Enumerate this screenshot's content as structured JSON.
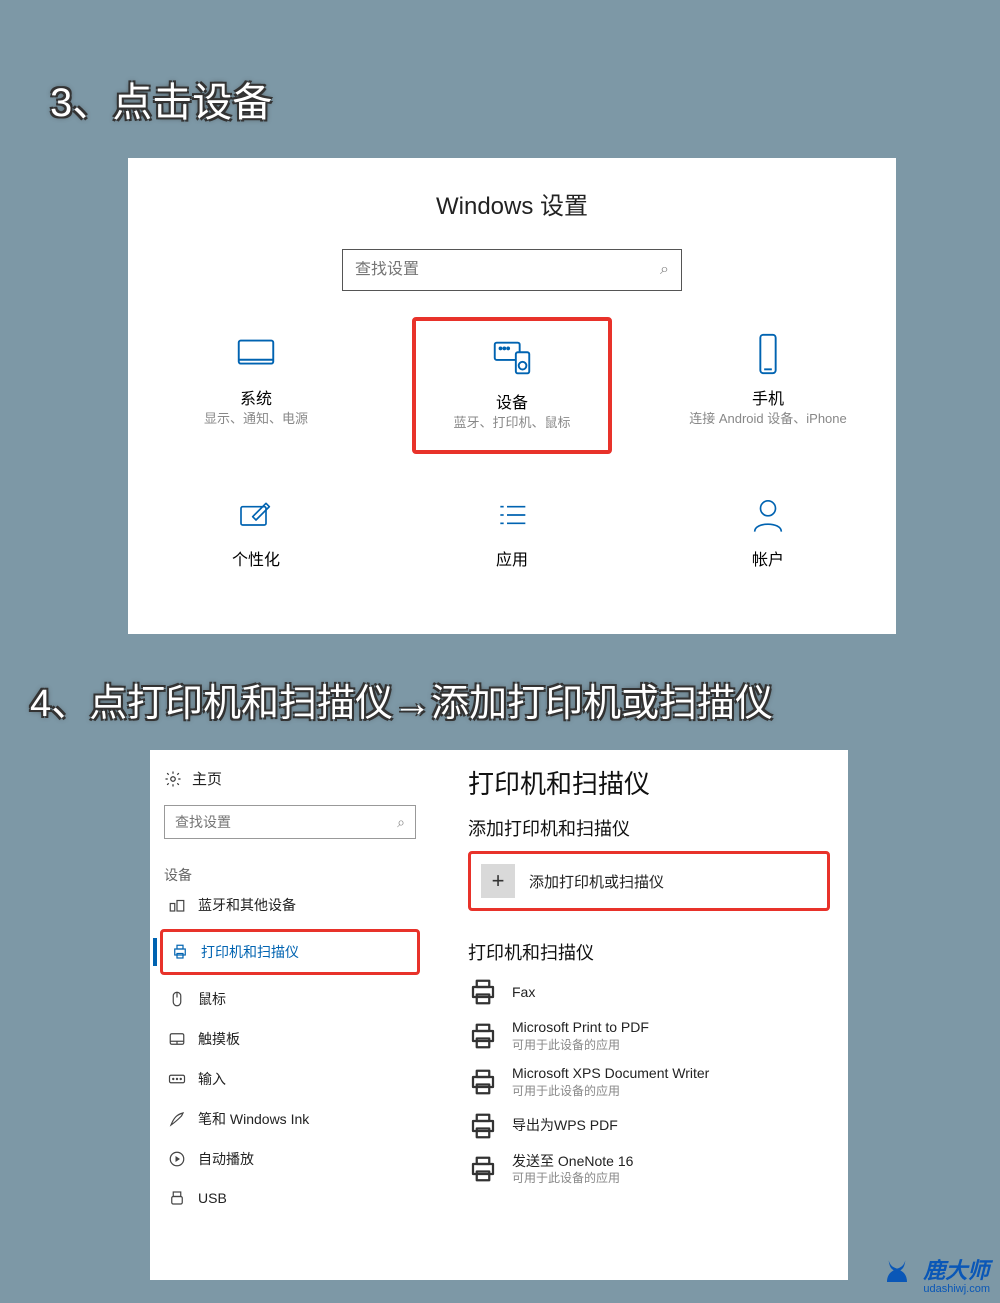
{
  "steps": {
    "s3": "3、点击设备",
    "s4": "4、点打印机和扫描仪→添加打印机或扫描仪"
  },
  "panel1": {
    "title": "Windows 设置",
    "search_placeholder": "查找设置",
    "cats": [
      {
        "title": "系统",
        "desc": "显示、通知、电源"
      },
      {
        "title": "设备",
        "desc": "蓝牙、打印机、鼠标"
      },
      {
        "title": "手机",
        "desc": "连接 Android 设备、iPhone"
      }
    ],
    "cats2": [
      {
        "title": "个性化"
      },
      {
        "title": "应用"
      },
      {
        "title": "帐户"
      }
    ]
  },
  "panel2": {
    "home": "主页",
    "search_placeholder": "查找设置",
    "group": "设备",
    "nav": [
      "蓝牙和其他设备",
      "打印机和扫描仪",
      "鼠标",
      "触摸板",
      "输入",
      "笔和 Windows Ink",
      "自动播放",
      "USB"
    ],
    "heading": "打印机和扫描仪",
    "add_heading": "添加打印机和扫描仪",
    "add_button": "添加打印机或扫描仪",
    "list_heading": "打印机和扫描仪",
    "app_sub": "可用于此设备的应用",
    "printers": [
      {
        "name": "Fax",
        "sub": ""
      },
      {
        "name": "Microsoft Print to PDF",
        "sub": "可用于此设备的应用"
      },
      {
        "name": "Microsoft XPS Document Writer",
        "sub": "可用于此设备的应用"
      },
      {
        "name": "导出为WPS PDF",
        "sub": ""
      },
      {
        "name": "发送至 OneNote 16",
        "sub": "可用于此设备的应用"
      }
    ]
  },
  "watermark": {
    "brand": "鹿大师",
    "url": "udashiwj.com"
  }
}
